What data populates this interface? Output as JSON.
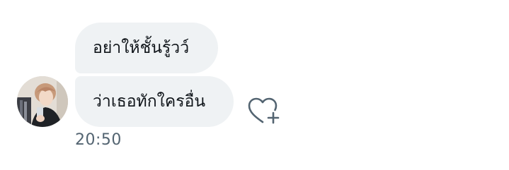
{
  "messages": [
    {
      "text": "อย่าให้ชั้นรู้วว์"
    },
    {
      "text": "ว่าเธอทักใครอื่น"
    }
  ],
  "timestamp": "20:50",
  "react_icon": "heart-plus-icon",
  "colors": {
    "bubble_bg": "#eff2f4",
    "text": "#0f1419",
    "secondary_text": "#536471"
  }
}
